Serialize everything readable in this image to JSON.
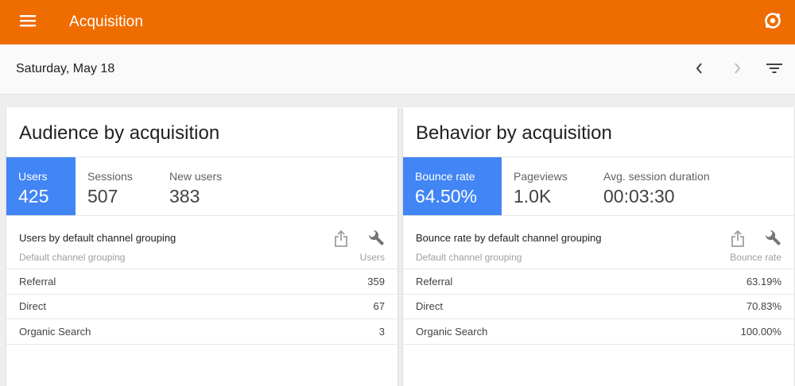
{
  "appbar": {
    "title": "Acquisition",
    "menu_icon": "menu-icon",
    "account_icon": "account-switcher-icon"
  },
  "datebar": {
    "date": "Saturday, May 18",
    "prev_icon": "chevron-left-icon",
    "next_icon": "chevron-right-icon",
    "filter_icon": "filter-icon"
  },
  "cards": [
    {
      "title": "Audience by acquisition",
      "metrics": [
        {
          "label": "Users",
          "value": "425",
          "active": true
        },
        {
          "label": "Sessions",
          "value": "507",
          "active": false
        },
        {
          "label": "New users",
          "value": "383",
          "active": false
        }
      ],
      "table": {
        "title": "Users by default channel grouping",
        "dimension_label": "Default channel grouping",
        "metric_label": "Users",
        "rows": [
          {
            "name": "Referral",
            "value": "359"
          },
          {
            "name": "Direct",
            "value": "67"
          },
          {
            "name": "Organic Search",
            "value": "3"
          }
        ]
      }
    },
    {
      "title": "Behavior by acquisition",
      "metrics": [
        {
          "label": "Bounce rate",
          "value": "64.50%",
          "active": true
        },
        {
          "label": "Pageviews",
          "value": "1.0K",
          "active": false
        },
        {
          "label": "Avg. session duration",
          "value": "00:03:30",
          "active": false
        }
      ],
      "table": {
        "title": "Bounce rate by default channel grouping",
        "dimension_label": "Default channel grouping",
        "metric_label": "Bounce rate",
        "rows": [
          {
            "name": "Referral",
            "value": "63.19%"
          },
          {
            "name": "Direct",
            "value": "70.83%"
          },
          {
            "name": "Organic Search",
            "value": "100.00%"
          }
        ]
      }
    }
  ],
  "colors": {
    "appbar": "#ef6c00",
    "active_metric": "#4285f4",
    "background": "#eeeeee"
  }
}
